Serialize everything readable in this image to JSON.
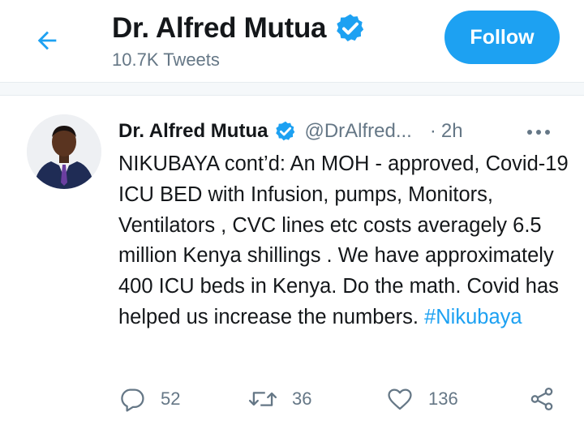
{
  "header": {
    "name": "Dr. Alfred Mutua",
    "tweet_count": "10.7K Tweets",
    "follow_label": "Follow"
  },
  "tweet": {
    "author_name": "Dr. Alfred Mutua",
    "handle": "@DrAlfred...",
    "separator": "·",
    "time": "2h",
    "text_main": "NIKUBAYA cont’d: An MOH - approved, Covid-19 ICU BED with Infusion, pumps, Monitors, Ventilators , CVC lines etc costs averagely 6.5 million Kenya shillings . We have approximately 400 ICU beds in Kenya. Do the math. Covid has helped us increase the numbers.",
    "hashtag": "#Nikubaya",
    "reply_count": "52",
    "retweet_count": "36",
    "like_count": "136"
  },
  "colors": {
    "accent": "#1da1f2",
    "text_primary": "#14171a",
    "text_secondary": "#657786"
  },
  "icons": {
    "back": "arrow-left-icon",
    "verified": "verified-badge-icon",
    "more": "more-icon",
    "reply": "reply-icon",
    "retweet": "retweet-icon",
    "like": "heart-icon",
    "share": "share-icon"
  }
}
